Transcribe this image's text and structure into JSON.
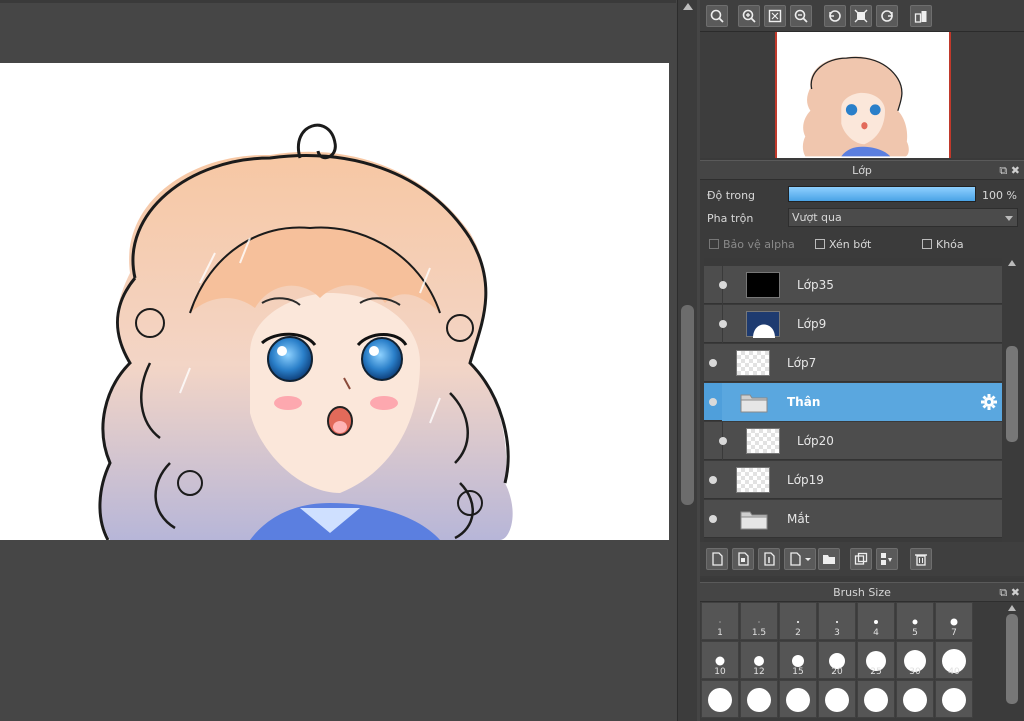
{
  "layer_panel": {
    "title": "Lớp",
    "opacity_label": "Độ trong",
    "opacity_value": "100 %",
    "opacity_fraction": 1.0,
    "blend_label": "Pha trộn",
    "blend_value": "Vượt qua",
    "protect_alpha": "Bảo vệ alpha",
    "clipping": "Xén bớt",
    "lock": "Khóa",
    "layers": [
      {
        "name": "Lớp35",
        "thumb": "black",
        "indented": true,
        "selected": false,
        "folder": false
      },
      {
        "name": "Lớp9",
        "thumb": "white-shape",
        "indented": true,
        "selected": false,
        "folder": false
      },
      {
        "name": "Lớp7",
        "thumb": "transparent",
        "indented": false,
        "selected": false,
        "folder": false
      },
      {
        "name": "Thân",
        "thumb": "folder",
        "indented": false,
        "selected": true,
        "folder": true
      },
      {
        "name": "Lớp20",
        "thumb": "transparent",
        "indented": true,
        "selected": false,
        "folder": false
      },
      {
        "name": "Lớp19",
        "thumb": "transparent",
        "indented": false,
        "selected": false,
        "folder": false
      },
      {
        "name": "Mắt",
        "thumb": "folder",
        "indented": false,
        "selected": false,
        "folder": true
      }
    ]
  },
  "brush_panel": {
    "title": "Brush Size",
    "sizes": [
      "1",
      "1.5",
      "2",
      "3",
      "4",
      "5",
      "7",
      "10",
      "12",
      "15",
      "20",
      "25",
      "30",
      "40",
      "",
      "",
      "",
      "",
      "",
      "",
      ""
    ]
  },
  "colors": {
    "accent": "#4f9fdb",
    "panel": "#3b3b3b",
    "canvas_bg": "#464646",
    "hair": "#f6c9a6",
    "eyes": "#2a7fc9"
  }
}
